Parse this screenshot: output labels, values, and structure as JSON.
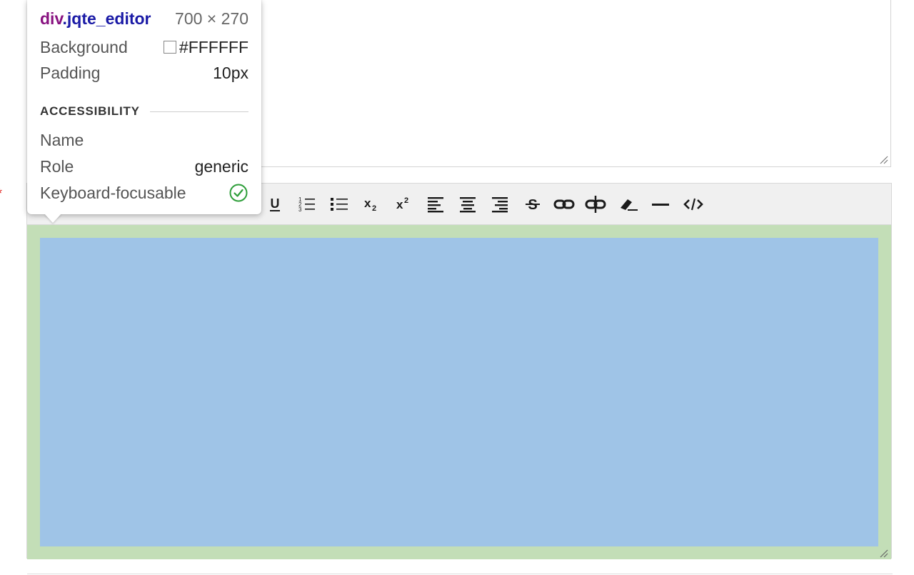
{
  "tooltip": {
    "element_tag": "div",
    "element_class": ".jqte_editor",
    "dimensions": "700 × 270",
    "properties": [
      {
        "label": "Background",
        "value": "#FFFFFF"
      },
      {
        "label": "Padding",
        "value": "10px"
      }
    ],
    "section_title": "ACCESSIBILITY",
    "accessibility": [
      {
        "label": "Name",
        "value": ""
      },
      {
        "label": "Role",
        "value": "generic"
      },
      {
        "label": "Keyboard-focusable",
        "value": ""
      }
    ]
  },
  "required_mark": "*",
  "toolbar": {
    "buttons": [
      {
        "name": "underline",
        "text": "U"
      },
      {
        "name": "ordered-list",
        "text": ""
      },
      {
        "name": "unordered-list",
        "text": ""
      },
      {
        "name": "subscript",
        "text": ""
      },
      {
        "name": "superscript",
        "text": ""
      },
      {
        "name": "align-left",
        "text": ""
      },
      {
        "name": "align-center",
        "text": ""
      },
      {
        "name": "align-right",
        "text": ""
      },
      {
        "name": "strikethrough",
        "text": ""
      },
      {
        "name": "link",
        "text": ""
      },
      {
        "name": "unlink",
        "text": ""
      },
      {
        "name": "remove-format",
        "text": ""
      },
      {
        "name": "horizontal-rule",
        "text": ""
      },
      {
        "name": "source",
        "text": ""
      }
    ]
  },
  "colors": {
    "padding_overlay": "#c3deb7",
    "content_overlay": "#9fc4e7",
    "toolbar_bg": "#f0f0f0",
    "element_tag_color": "#881280",
    "element_class_color": "#1a1aa6",
    "check_green": "#2e9e3a"
  }
}
